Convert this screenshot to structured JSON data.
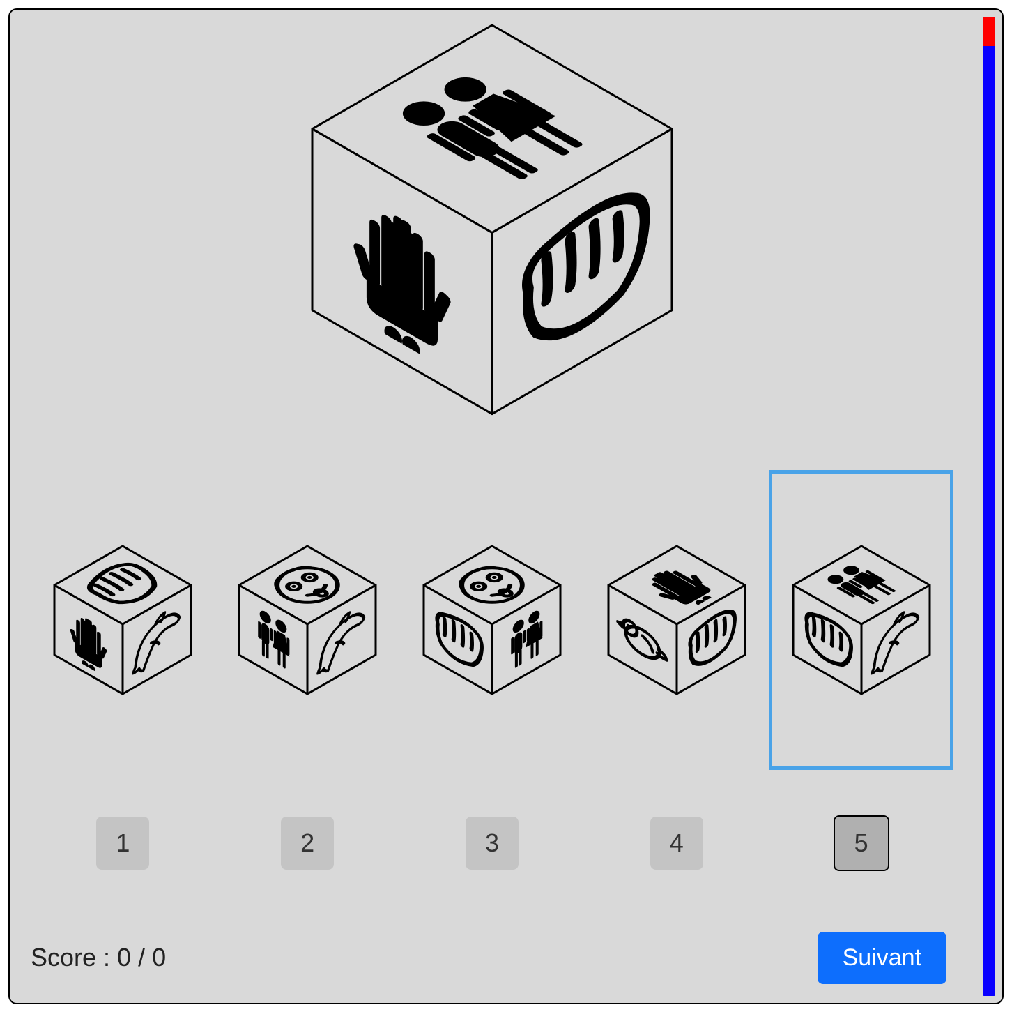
{
  "score_label": "Score : 0 / 0",
  "next_button_label": "Suivant",
  "timer": {
    "elapsed_percent": 3
  },
  "selected_option_index": 4,
  "options": [
    {
      "label": "1",
      "top_face": "fist",
      "left_face": "hands",
      "right_face": "dolphin"
    },
    {
      "label": "2",
      "top_face": "face",
      "left_face": "couple",
      "right_face": "dolphin"
    },
    {
      "label": "3",
      "top_face": "face",
      "left_face": "fist",
      "right_face": "couple"
    },
    {
      "label": "4",
      "top_face": "hands",
      "left_face": "bird",
      "right_face": "fist"
    },
    {
      "label": "5",
      "top_face": "couple",
      "left_face": "fist",
      "right_face": "dolphin"
    }
  ],
  "big_cube": {
    "top_face": "couple",
    "left_face": "hands",
    "right_face": "fist"
  }
}
